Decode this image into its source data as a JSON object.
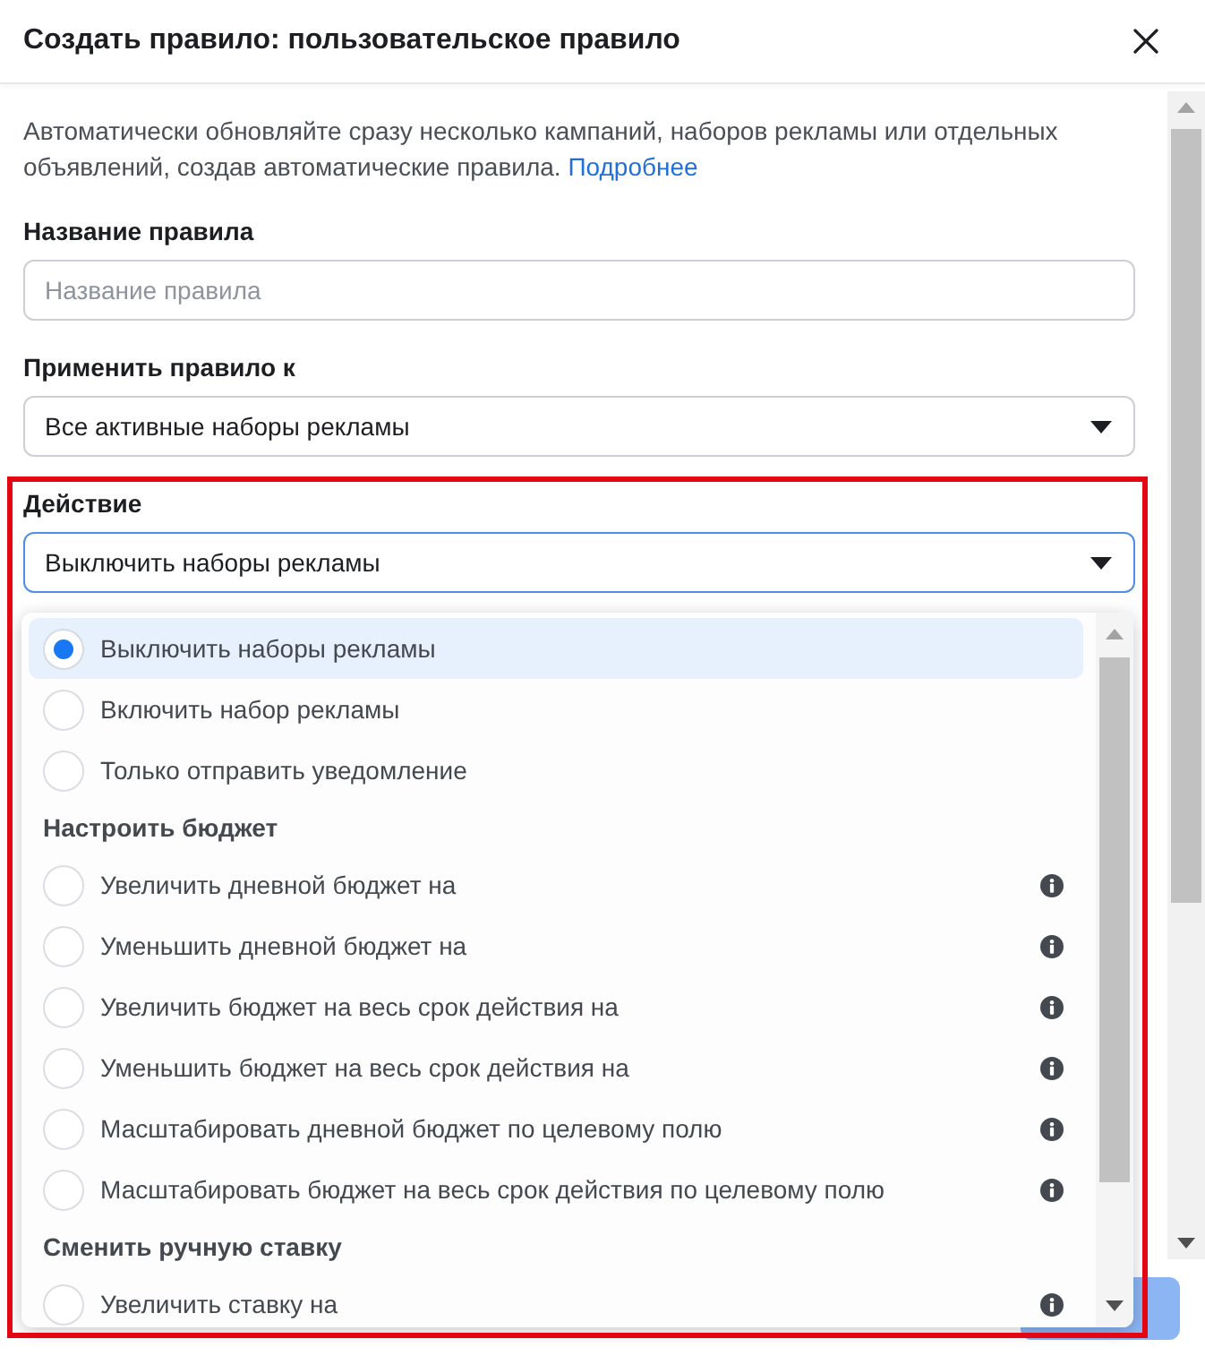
{
  "dialog": {
    "title": "Создать правило: пользовательское правило"
  },
  "description": {
    "text": "Автоматически обновляйте сразу несколько кампаний, наборов рекламы или отдельных объявлений, создав автоматические правила.",
    "link": "Подробнее"
  },
  "fields": [
    {
      "kind": "input",
      "label": "Название правила",
      "placeholder": "Название правила",
      "focused": false
    },
    {
      "kind": "select",
      "label": "Применить правило к",
      "value": "Все активные наборы рекламы",
      "focused": false
    },
    {
      "kind": "select",
      "label": "Действие",
      "value": "Выключить наборы рекламы",
      "focused": true,
      "highlighted": true,
      "options": [
        {
          "kind": "option",
          "label": "Выключить наборы рекламы",
          "selected": true,
          "info": false
        },
        {
          "kind": "option",
          "label": "Включить набор рекламы",
          "selected": false,
          "info": false
        },
        {
          "kind": "option",
          "label": "Только отправить уведомление",
          "selected": false,
          "info": false
        },
        {
          "kind": "heading",
          "label": "Настроить бюджет"
        },
        {
          "kind": "option",
          "label": "Увеличить дневной бюджет на",
          "selected": false,
          "info": true
        },
        {
          "kind": "option",
          "label": "Уменьшить дневной бюджет на",
          "selected": false,
          "info": true
        },
        {
          "kind": "option",
          "label": "Увеличить бюджет на весь срок действия на",
          "selected": false,
          "info": true
        },
        {
          "kind": "option",
          "label": "Уменьшить бюджет на весь срок действия на",
          "selected": false,
          "info": true
        },
        {
          "kind": "option",
          "label": "Масштабировать дневной бюджет по целевому полю",
          "selected": false,
          "info": true
        },
        {
          "kind": "option",
          "label": "Масштабировать бюджет на весь срок действия по целевому полю",
          "selected": false,
          "info": true
        },
        {
          "kind": "heading",
          "label": "Сменить ручную ставку"
        },
        {
          "kind": "option",
          "label": "Увеличить ставку на",
          "selected": false,
          "info": true
        }
      ]
    }
  ]
}
